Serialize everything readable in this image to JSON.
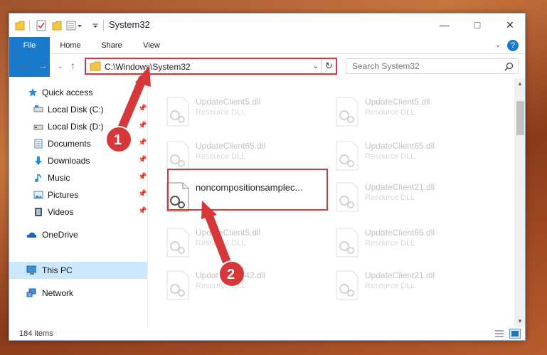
{
  "window": {
    "title": "System32"
  },
  "ribbon": {
    "tabs": [
      "File",
      "Home",
      "Share",
      "View"
    ]
  },
  "address": {
    "path": "C:\\Windows\\System32"
  },
  "search": {
    "placeholder": "Search System32"
  },
  "sidebar": {
    "items": [
      {
        "label": "Quick access",
        "icon": "star-icon"
      },
      {
        "label": "Local Disk (C:)",
        "icon": "drive-icon"
      },
      {
        "label": "Local Disk (D:)",
        "icon": "drive-icon"
      },
      {
        "label": "Documents",
        "icon": "documents-icon"
      },
      {
        "label": "Downloads",
        "icon": "download-icon"
      },
      {
        "label": "Music",
        "icon": "music-icon"
      },
      {
        "label": "Pictures",
        "icon": "pictures-icon"
      },
      {
        "label": "Videos",
        "icon": "videos-icon"
      },
      {
        "label": "OneDrive",
        "icon": "cloud-icon"
      },
      {
        "label": "This PC",
        "icon": "computer-icon"
      },
      {
        "label": "Network",
        "icon": "network-icon"
      }
    ]
  },
  "files": [
    {
      "name": "UpdateClient5.dll",
      "type": "Resource DLL"
    },
    {
      "name": "UpdateClient5.dll",
      "type": "Resource DLL"
    },
    {
      "name": "UpdateClient65.dll",
      "type": "Resource DLL"
    },
    {
      "name": "UpdateClient65.dll",
      "type": "Resource DLL"
    },
    {
      "name": "noncompositionsamplec...",
      "type": ""
    },
    {
      "name": "UpdateClient21.dll",
      "type": "Resource DLL"
    },
    {
      "name": "UpdateClient5.dll",
      "type": "Resource DLL"
    },
    {
      "name": "UpdateClient65.dll",
      "type": "Resource DLL"
    },
    {
      "name": "UpdateClient42.dll",
      "type": "Resource DLL"
    },
    {
      "name": "UpdateClient21.dll",
      "type": "Resource DLL"
    }
  ],
  "status": {
    "count": "184 items"
  },
  "annotations": {
    "step1": "1",
    "step2": "2"
  },
  "colors": {
    "accent": "#1979ca",
    "highlight": "#d6383a",
    "selected": "#cce8ff"
  }
}
